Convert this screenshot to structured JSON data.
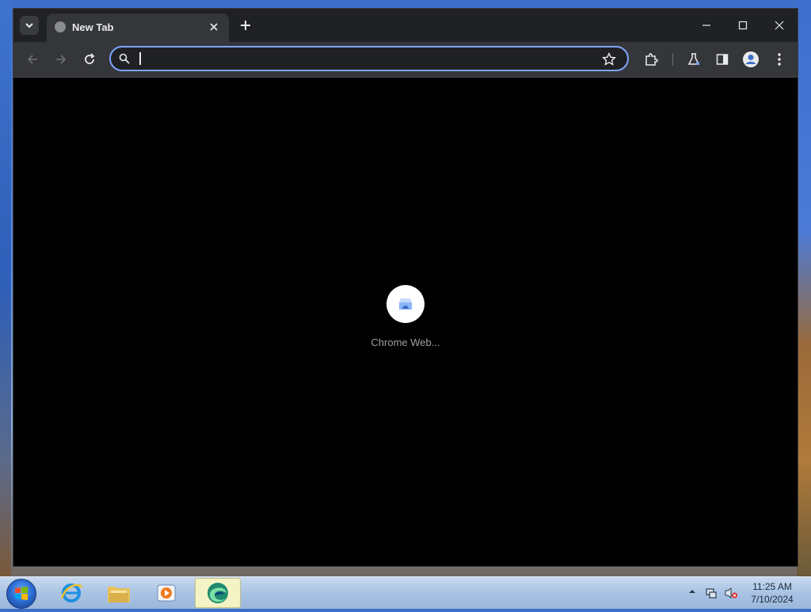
{
  "browser": {
    "tab": {
      "title": "New Tab"
    },
    "omnibox": {
      "value": "",
      "placeholder": ""
    }
  },
  "content": {
    "loader_label": "Chrome Web..."
  },
  "taskbar": {
    "clock": {
      "time": "11:25 AM",
      "date": "7/10/2024"
    }
  },
  "colors": {
    "accent": "#7ca4ff",
    "chrome_dark": "#202124",
    "toolbar": "#35363a"
  }
}
